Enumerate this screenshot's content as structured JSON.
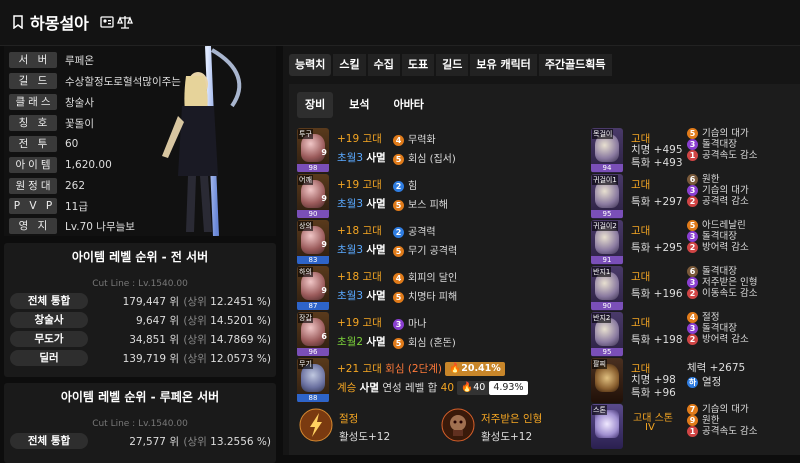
{
  "header": {
    "name": "하몽설아"
  },
  "profile": {
    "rows": [
      {
        "label": "서 버",
        "value": "루페온"
      },
      {
        "label": "길 드",
        "value": "수상할정도로혈석많이주는"
      },
      {
        "label": "클래스",
        "value": "창술사"
      },
      {
        "label": "칭 호",
        "value": "꽃돌이"
      },
      {
        "label": "전 투",
        "value": "60"
      },
      {
        "label": "아이템",
        "value": "1,620.00"
      },
      {
        "label": "원정대",
        "value": "262"
      },
      {
        "label": "P V P",
        "value": "11급"
      },
      {
        "label": "영 지",
        "value": "Lv.70 나무늘보"
      }
    ]
  },
  "rank_all": {
    "title": "아이템 레벨 순위 - 전 서버",
    "cutline": "Cut Line : Lv.1540.00",
    "rows": [
      {
        "label": "전체 통합",
        "value": "179,447 위",
        "pre": "(상위",
        "pct": "12.2451 %)"
      },
      {
        "label": "창술사",
        "value": "9,647 위",
        "pre": "(상위",
        "pct": "14.5201 %)"
      },
      {
        "label": "무도가",
        "value": "34,851 위",
        "pre": "(상위",
        "pct": "14.7869 %)"
      },
      {
        "label": "딜러",
        "value": "139,719 위",
        "pre": "(상위",
        "pct": "12.0573 %)"
      }
    ]
  },
  "rank_server": {
    "title": "아이템 레벨 순위 - 루페온 서버",
    "cutline": "Cut Line : Lv.1540.00",
    "rows": [
      {
        "label": "전체 통합",
        "value": "27,577 위",
        "pre": "(상위",
        "pct": "13.2556 %)"
      }
    ]
  },
  "tabs": [
    "능력치",
    "스킬",
    "수집",
    "도표",
    "길드",
    "보유 캐릭터",
    "주간골드획득"
  ],
  "subtabs": [
    "장비",
    "보석",
    "아바타"
  ],
  "equipment": [
    {
      "slot": "투구",
      "num": "98",
      "lvl": "9",
      "refine": "+19 고대",
      "trans_a": "초월3",
      "trans_b": "사멸",
      "effects": [
        {
          "n": "4",
          "t": "무력화",
          "c": "bo"
        },
        {
          "n": "5",
          "t": "회심 (집서)",
          "c": "bo"
        }
      ]
    },
    {
      "slot": "어깨",
      "num": "90",
      "lvl": "9",
      "refine": "+19 고대",
      "trans_a": "초월3",
      "trans_b": "사멸",
      "effects": [
        {
          "n": "2",
          "t": "힘",
          "c": "bb"
        },
        {
          "n": "5",
          "t": "보스 피해",
          "c": "bo"
        }
      ]
    },
    {
      "slot": "상의",
      "num": "83",
      "lvl": "9",
      "refine": "+18 고대",
      "trans_a": "초월3",
      "trans_b": "사멸",
      "effects": [
        {
          "n": "2",
          "t": "공격력",
          "c": "bb"
        },
        {
          "n": "5",
          "t": "무기 공격력",
          "c": "bo"
        }
      ]
    },
    {
      "slot": "하의",
      "num": "87",
      "lvl": "9",
      "refine": "+18 고대",
      "trans_a": "초월3",
      "trans_b": "사멸",
      "effects": [
        {
          "n": "4",
          "t": "회피의 달인",
          "c": "bo"
        },
        {
          "n": "5",
          "t": "치명타 피해",
          "c": "bo"
        }
      ]
    },
    {
      "slot": "장갑",
      "num": "96",
      "lvl": "6",
      "refine": "+19 고대",
      "trans_a": "초월2",
      "trans_b": "사멸",
      "effects": [
        {
          "n": "3",
          "t": "마나",
          "c": "bpu"
        },
        {
          "n": "5",
          "t": "회심 (혼돈)",
          "c": "bo"
        }
      ]
    }
  ],
  "weapon": {
    "slot": "무기",
    "num": "88",
    "refine": "+21 고대",
    "set_name": "회심 (2단계)",
    "line2_a": "계승",
    "line2_b": "사멸",
    "line2_c": "연성 레벨 합",
    "line2_d": "40",
    "quality_pct": "20.41%",
    "lvl_pill": "40",
    "pct_pill": "4.93%"
  },
  "engravings": [
    {
      "name": "절정",
      "value": "활성도+12"
    },
    {
      "name": "저주받은 인형",
      "value": "활성도+12"
    }
  ],
  "accessories": [
    {
      "slot": "목걸이",
      "num": "94",
      "grade": "고대",
      "stat1": "치명 +495",
      "stat2": "특화 +493",
      "effects": [
        {
          "n": "5",
          "t": "기습의 대가",
          "c": "bo"
        },
        {
          "n": "3",
          "t": "돌격대장",
          "c": "bpu"
        },
        {
          "n": "1",
          "t": "공격속도 감소",
          "c": "br"
        }
      ]
    },
    {
      "slot": "귀걸이1",
      "num": "95",
      "grade": "고대",
      "stat1": "특화 +297",
      "stat2": "",
      "effects": [
        {
          "n": "6",
          "t": "원한",
          "c": "bbw"
        },
        {
          "n": "3",
          "t": "기습의 대가",
          "c": "bpu"
        },
        {
          "n": "2",
          "t": "공격력 감소",
          "c": "br"
        }
      ]
    },
    {
      "slot": "귀걸이2",
      "num": "91",
      "grade": "고대",
      "stat1": "특화 +295",
      "stat2": "",
      "effects": [
        {
          "n": "5",
          "t": "아드레날린",
          "c": "bo"
        },
        {
          "n": "3",
          "t": "돌격대장",
          "c": "bpu"
        },
        {
          "n": "2",
          "t": "방어력 감소",
          "c": "br"
        }
      ]
    },
    {
      "slot": "반지1",
      "num": "90",
      "grade": "고대",
      "stat1": "특화 +196",
      "stat2": "",
      "effects": [
        {
          "n": "6",
          "t": "돌격대장",
          "c": "bbw"
        },
        {
          "n": "3",
          "t": "저주받은 인형",
          "c": "bpu"
        },
        {
          "n": "2",
          "t": "이동속도 감소",
          "c": "br"
        }
      ]
    },
    {
      "slot": "반지2",
      "num": "95",
      "grade": "고대",
      "stat1": "특화 +198",
      "stat2": "",
      "effects": [
        {
          "n": "4",
          "t": "절정",
          "c": "bo"
        },
        {
          "n": "3",
          "t": "돌격대장",
          "c": "bpu"
        },
        {
          "n": "2",
          "t": "방어력 감소",
          "c": "br"
        }
      ]
    }
  ],
  "bracelet": {
    "slot": "팔찌",
    "grade": "고대",
    "stat1": "치명 +98",
    "stat2": "특화 +96",
    "stat3": "체력 +2675",
    "stat4": "열정",
    "stat4_badge": "하"
  },
  "stone": {
    "slot": "스톤",
    "name": "고대 스톤",
    "name2": "IV",
    "effects": [
      {
        "n": "7",
        "t": "기습의 대가",
        "c": "bo"
      },
      {
        "n": "9",
        "t": "원한",
        "c": "bo"
      },
      {
        "n": "1",
        "t": "공격속도 감소",
        "c": "br"
      }
    ]
  },
  "colors": {
    "accent_orange": "#f5a623",
    "blue": "#5aa9ff",
    "green": "#7bd13a"
  }
}
